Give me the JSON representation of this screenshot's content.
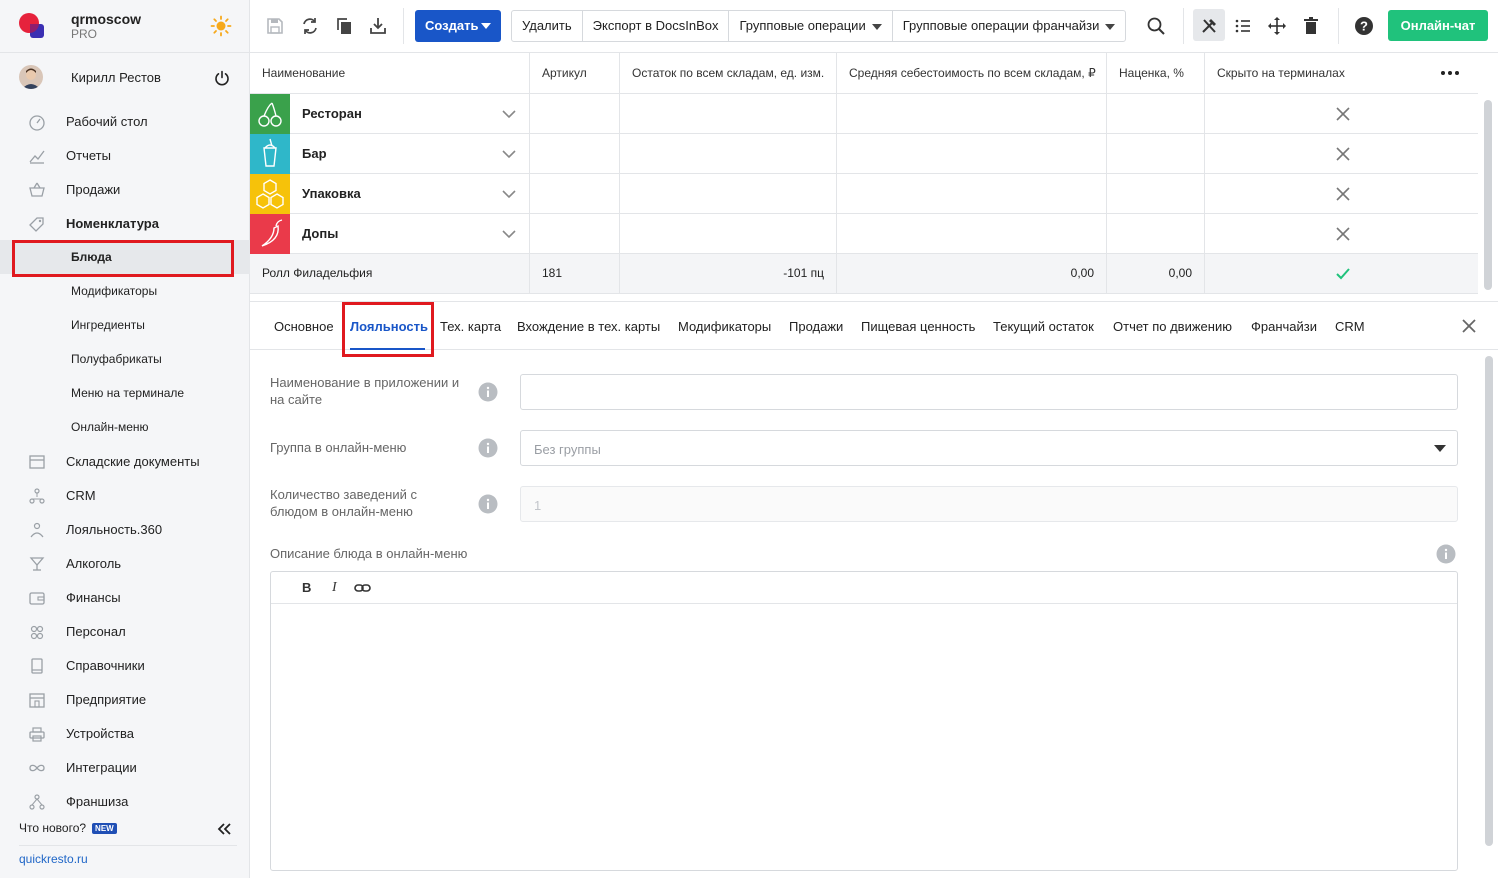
{
  "brand": {
    "name": "qrmoscow",
    "plan": "PRO"
  },
  "user": {
    "name": "Кирилл Рестов"
  },
  "sidebar": {
    "items": [
      {
        "label": "Рабочий стол",
        "icon": "dashboard-icon"
      },
      {
        "label": "Отчеты",
        "icon": "chart-icon"
      },
      {
        "label": "Продажи",
        "icon": "basket-icon"
      },
      {
        "label": "Номенклатура",
        "icon": "tag-icon"
      },
      {
        "label": "Блюда"
      },
      {
        "label": "Модификаторы"
      },
      {
        "label": "Ингредиенты"
      },
      {
        "label": "Полуфабрикаты"
      },
      {
        "label": "Меню на терминале"
      },
      {
        "label": "Онлайн-меню"
      },
      {
        "label": "Складские документы",
        "icon": "warehouse-icon"
      },
      {
        "label": "CRM",
        "icon": "crm-icon"
      },
      {
        "label": "Лояльность.360",
        "icon": "loyalty-icon"
      },
      {
        "label": "Алкоголь",
        "icon": "glass-icon"
      },
      {
        "label": "Финансы",
        "icon": "wallet-icon"
      },
      {
        "label": "Персонал",
        "icon": "people-icon"
      },
      {
        "label": "Справочники",
        "icon": "book-icon"
      },
      {
        "label": "Предприятие",
        "icon": "store-icon"
      },
      {
        "label": "Устройства",
        "icon": "printer-icon"
      },
      {
        "label": "Интеграции",
        "icon": "infinity-icon"
      },
      {
        "label": "Франшиза",
        "icon": "franchise-icon"
      }
    ],
    "whats_new": "Что нового?",
    "new_badge": "NEW",
    "site": "quickresto.ru"
  },
  "toolbar": {
    "create": "Создать",
    "delete": "Удалить",
    "export": "Экспорт в DocsInBox",
    "group_ops": "Групповые операции",
    "group_ops_franchise": "Групповые операции франчайзи",
    "chat": "Онлайн-чат"
  },
  "table": {
    "headers": [
      "Наименование",
      "Артикул",
      "Остаток по всем складам, ед. изм.",
      "Средняя себестоимость по всем складам, ₽",
      "Наценка, %",
      "Скрыто на терминалах"
    ],
    "categories": [
      {
        "name": "Ресторан",
        "color": "#3aa14b",
        "icon": "cherry-icon"
      },
      {
        "name": "Бар",
        "color": "#2fb7c9",
        "icon": "drink-icon"
      },
      {
        "name": "Упаковка",
        "color": "#f6c20a",
        "icon": "honeycomb-icon"
      },
      {
        "name": "Допы",
        "color": "#ea3a4a",
        "icon": "pepper-icon"
      }
    ],
    "item": {
      "name": "Ролл Филадельфия",
      "sku": "181",
      "stock": "-101 пц",
      "cost": "0,00",
      "markup": "0,00"
    }
  },
  "tabs": [
    "Основное",
    "Лояльность",
    "Тех. карта",
    "Вхождение в тех. карты",
    "Модификаторы",
    "Продажи",
    "Пищевая ценность",
    "Текущий остаток",
    "Отчет по движению",
    "Франчайзи",
    "CRM"
  ],
  "form": {
    "app_name_label": "Наименование в приложении и на сайте",
    "group_label": "Группа в онлайн-меню",
    "group_value": "Без группы",
    "venues_label": "Количество заведений с блюдом в онлайн-меню",
    "venues_placeholder": "1",
    "description_label": "Описание блюда в онлайн-меню",
    "editor": {
      "bold": "B",
      "italic": "I"
    }
  },
  "colors": {
    "accent": "#1956c8",
    "chat": "#20c27c",
    "highlight": "#e0191f",
    "check": "#20c27c"
  }
}
